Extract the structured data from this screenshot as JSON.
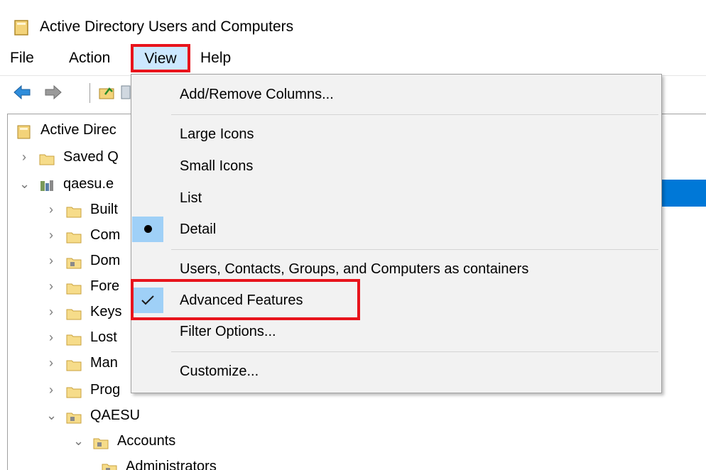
{
  "window": {
    "title": "Active Directory Users and Computers"
  },
  "menubar": {
    "file": "File",
    "action": "Action",
    "view": "View",
    "help": "Help"
  },
  "tree": [
    {
      "label": "Active Direc",
      "chevron": "",
      "indent": 0,
      "icon": "snapin-icon"
    },
    {
      "label": "Saved Q",
      "chevron": "›",
      "indent": 1,
      "icon": "folder-icon"
    },
    {
      "label": "qaesu.e ",
      "chevron": "⌄",
      "indent": 1,
      "icon": "domain-icon"
    },
    {
      "label": "Built",
      "chevron": "›",
      "indent": 2,
      "icon": "folder-icon"
    },
    {
      "label": "Com",
      "chevron": "›",
      "indent": 2,
      "icon": "folder-icon"
    },
    {
      "label": "Dom",
      "chevron": "›",
      "indent": 2,
      "icon": "ou-icon"
    },
    {
      "label": "Fore",
      "chevron": "›",
      "indent": 2,
      "icon": "folder-icon"
    },
    {
      "label": "Keys",
      "chevron": "›",
      "indent": 2,
      "icon": "folder-icon"
    },
    {
      "label": "Lost",
      "chevron": "›",
      "indent": 2,
      "icon": "folder-icon"
    },
    {
      "label": "Man",
      "chevron": "›",
      "indent": 2,
      "icon": "folder-icon"
    },
    {
      "label": "Prog",
      "chevron": "›",
      "indent": 2,
      "icon": "folder-icon"
    },
    {
      "label": "QAESU",
      "chevron": "⌄",
      "indent": 2,
      "icon": "ou-icon"
    },
    {
      "label": "Accounts",
      "chevron": "⌄",
      "indent": 3,
      "icon": "ou-icon"
    },
    {
      "label": "Administrators",
      "chevron": "",
      "indent": 4,
      "icon": "ou-icon"
    }
  ],
  "view_menu": {
    "add_remove_columns": "Add/Remove Columns...",
    "large_icons": "Large Icons",
    "small_icons": "Small Icons",
    "list": "List",
    "detail": "Detail",
    "users_as_containers": "Users, Contacts, Groups, and Computers as containers",
    "advanced_features": "Advanced Features",
    "filter_options": "Filter Options...",
    "customize": "Customize..."
  },
  "colors": {
    "highlight_red": "#e8141c",
    "menu_selected": "#cce8ff",
    "check_bg": "#9fd0f7",
    "selection_blue": "#0078d7"
  }
}
